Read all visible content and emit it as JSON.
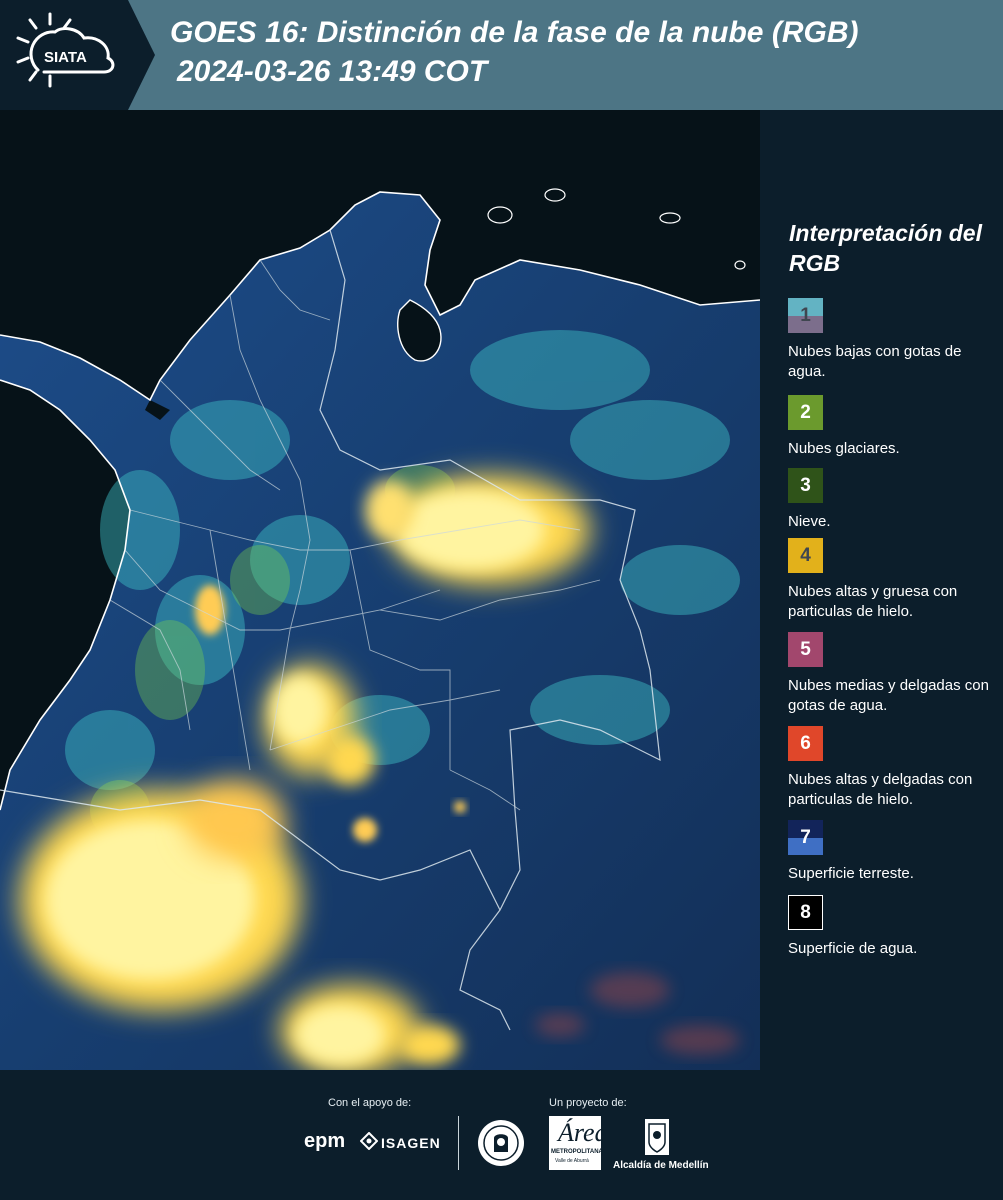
{
  "header": {
    "logo_text": "SIATA",
    "title_line1": "GOES 16: Distinción de la fase de la nube (RGB)",
    "title_line2": "2024-03-26 13:49 COT"
  },
  "colors": {
    "header_bg": "#4d7585",
    "page_bg": "#0c1e2b"
  },
  "legend": {
    "title": "Interpretación del RGB",
    "items": [
      {
        "num": "1",
        "desc": "Nubes bajas con gotas de agua.",
        "top_color": "#63b3c3",
        "bottom_color": "#7c6e8c",
        "num_color": "#3f4650"
      },
      {
        "num": "2",
        "desc": "Nubes glaciares.",
        "top_color": "#6b9a2d",
        "bottom_color": "#6b9a2d",
        "num_color": "#ffffff"
      },
      {
        "num": "3",
        "desc": "Nieve.",
        "top_color": "#2f5319",
        "bottom_color": "#2f5319",
        "num_color": "#ffffff"
      },
      {
        "num": "4",
        "desc": "Nubes altas y gruesa con particulas de hielo.",
        "top_color": "#e2b11b",
        "bottom_color": "#e2b11b",
        "num_color": "#3f4650"
      },
      {
        "num": "5",
        "desc": "Nubes medias y delgadas con gotas de agua.",
        "top_color": "#a2476d",
        "bottom_color": "#a2476d",
        "num_color": "#ffffff"
      },
      {
        "num": "6",
        "desc": "Nubes altas y delgadas con particulas de hielo.",
        "top_color": "#e0472a",
        "bottom_color": "#e0472a",
        "num_color": "#ffffff"
      },
      {
        "num": "7",
        "desc": "Superficie terreste.",
        "top_color": "#12245a",
        "bottom_color": "#3f6fc4",
        "num_color": "#ffffff"
      },
      {
        "num": "8",
        "desc": "Superficie de agua.",
        "top_color": "#000000",
        "bottom_color": "#000000",
        "num_color": "#ffffff"
      }
    ]
  },
  "footer": {
    "support_label": "Con el apoyo de:",
    "project_label": "Un proyecto de:",
    "brand_epm": "epm",
    "brand_isagen": "ISAGEN",
    "area_logo_text": "Área",
    "area_logo_sub1": "METROPOLITANA",
    "area_logo_sub2": "Valle de Aburrá",
    "alcaldia": "Alcaldía de Medellín"
  }
}
